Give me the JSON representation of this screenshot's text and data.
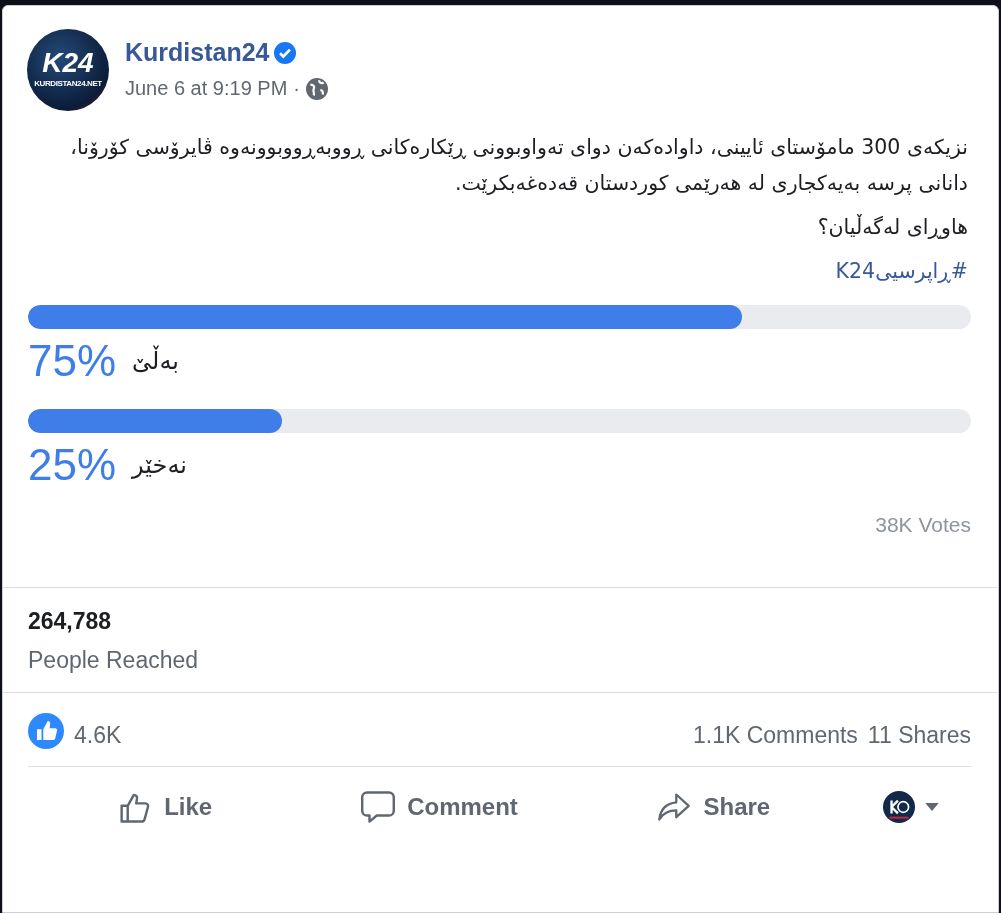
{
  "post": {
    "author": "Kurdistan24",
    "verified": true,
    "avatar_text": "K24",
    "avatar_subtext": "KURDISTAN24.NET",
    "time": "June 6 at 9:19 PM",
    "separator": "·",
    "text": "نزیکەی 300 مامۆستای ئایینی، داوادەکەن دوای تەواوبوونی ڕێکارەکانی ڕووبەڕووبوونەوە ڤایرۆسی کۆرۆنا، دانانی پرسە بەیەکجاری لە هەرێمی کوردستان قەدەغەبکرێت.",
    "question": "هاوڕای لەگەڵیان؟",
    "hashtag": "#ڕاپرسیی‌K24"
  },
  "poll": {
    "options": [
      {
        "percent": "75%",
        "label": "بەڵێ",
        "level": 0.757
      },
      {
        "percent": "25%",
        "label": "نەخێر",
        "level": 0.269
      }
    ],
    "votes": "38K Votes"
  },
  "insights": {
    "count": "264,788",
    "label": "People Reached"
  },
  "reactions": {
    "likes": "4.6K",
    "comments": "1.1K Comments",
    "shares": "11 Shares"
  },
  "actions": [
    {
      "kind": "like",
      "label": "Like"
    },
    {
      "kind": "comment",
      "label": "Comment"
    },
    {
      "kind": "share",
      "label": "Share"
    }
  ]
}
